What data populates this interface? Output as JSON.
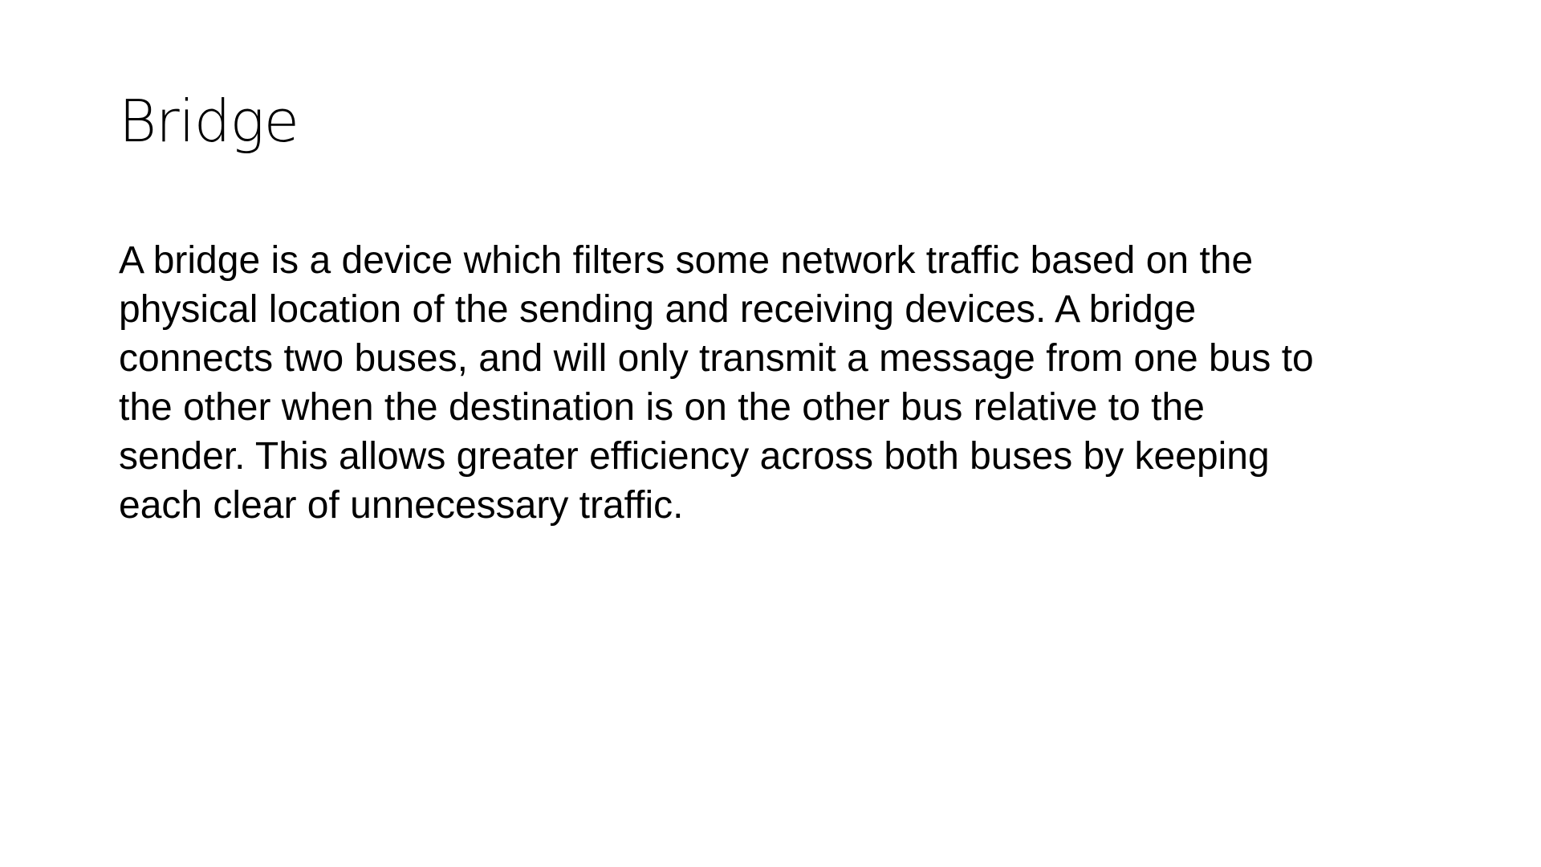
{
  "slide": {
    "title": "Bridge",
    "body_lines": [
      "A bridge is a device which filters some network traffic based on the",
      "physical location of the sending and receiving devices. A bridge",
      "connects two buses, and will only transmit a message from one bus to",
      "the other when the destination is on the other bus relative to the",
      "sender. This allows greater efficiency across both buses by keeping",
      "each clear of unnecessary traffic."
    ]
  }
}
